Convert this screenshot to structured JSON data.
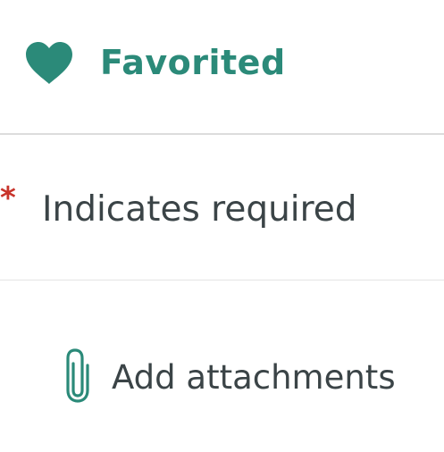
{
  "favorite": {
    "label": "Favorited",
    "icon": "heart-icon",
    "color": "#2b8a79"
  },
  "required_note": {
    "marker": "*",
    "marker_color": "#c8342b",
    "label": "Indicates required"
  },
  "attachments": {
    "label": "Add attachments",
    "icon": "paperclip-icon",
    "icon_color": "#2b8a79"
  }
}
